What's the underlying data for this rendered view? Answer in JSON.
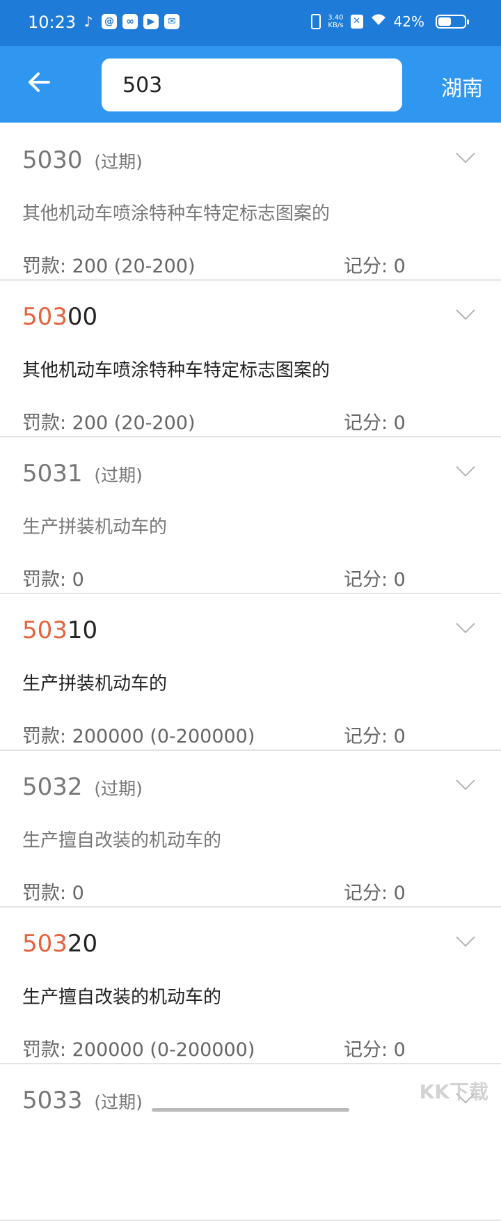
{
  "status_bar": {
    "time": "10:23",
    "speed_top": "3.40",
    "speed_bottom": "KB/s",
    "battery": "42%"
  },
  "header": {
    "search_value": "503",
    "region": "湖南"
  },
  "results": [
    {
      "code_prefix": "",
      "code_rest": "5030",
      "expired_label": "(过期)",
      "description": "其他机动车喷涂特种车特定标志图案的",
      "fine": "罚款: 200 (20-200)",
      "points": "记分: 0"
    },
    {
      "code_prefix": "503",
      "code_rest": "00",
      "expired_label": "",
      "description": "其他机动车喷涂特种车特定标志图案的",
      "fine": "罚款: 200 (20-200)",
      "points": "记分: 0"
    },
    {
      "code_prefix": "",
      "code_rest": "5031",
      "expired_label": "(过期)",
      "description": "生产拼装机动车的",
      "fine": "罚款: 0",
      "points": "记分: 0"
    },
    {
      "code_prefix": "503",
      "code_rest": "10",
      "expired_label": "",
      "description": "生产拼装机动车的",
      "fine": "罚款: 200000 (0-200000)",
      "points": "记分: 0"
    },
    {
      "code_prefix": "",
      "code_rest": "5032",
      "expired_label": "(过期)",
      "description": "生产擅自改装的机动车的",
      "fine": "罚款: 0",
      "points": "记分: 0"
    },
    {
      "code_prefix": "503",
      "code_rest": "20",
      "expired_label": "",
      "description": "生产擅自改装的机动车的",
      "fine": "罚款: 200000 (0-200000)",
      "points": "记分: 0"
    },
    {
      "code_prefix": "",
      "code_rest": "5033",
      "expired_label": "(过期)",
      "description": "",
      "fine": "",
      "points": ""
    }
  ],
  "watermark": "KK下载"
}
